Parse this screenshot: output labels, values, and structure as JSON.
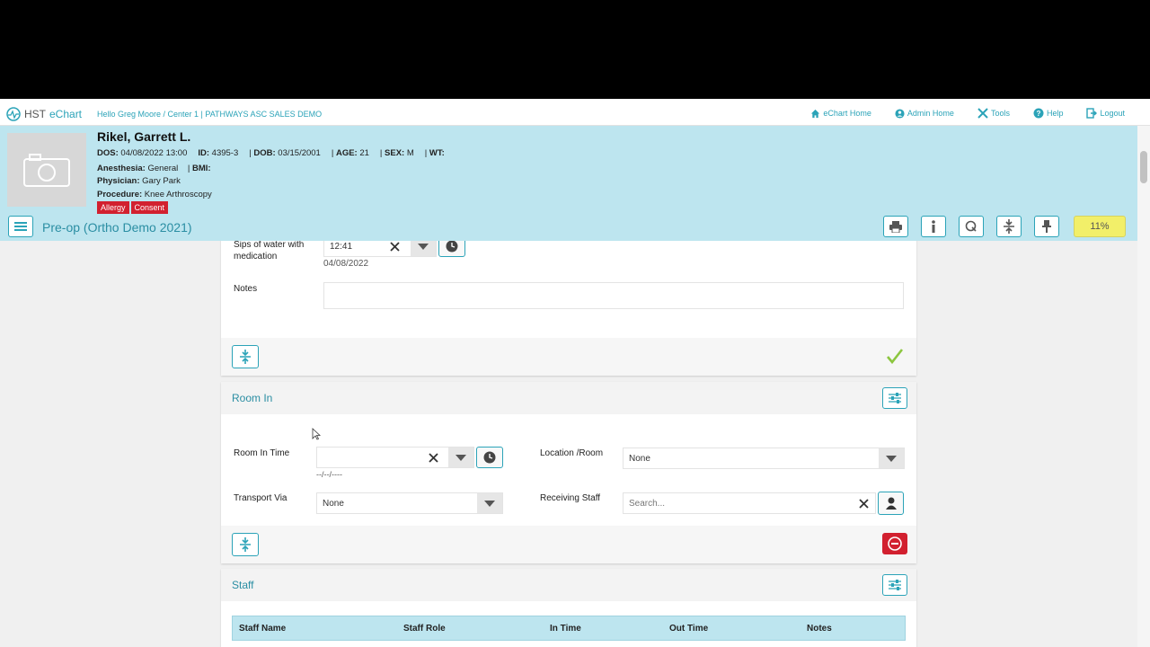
{
  "topbar": {
    "logo_text": "HST",
    "logo_accent": "eChart",
    "greeting": "Hello Greg Moore / Center 1 | PATHWAYS ASC SALES DEMO",
    "nav": [
      {
        "label": "eChart Home",
        "icon": "home-icon"
      },
      {
        "label": "Admin Home",
        "icon": "user-circle-icon"
      },
      {
        "label": "Tools",
        "icon": "tools-icon"
      },
      {
        "label": "Help",
        "icon": "help-icon"
      },
      {
        "label": "Logout",
        "icon": "logout-icon"
      }
    ]
  },
  "patient": {
    "name": "Rikel, Garrett L.",
    "dos_label": "DOS:",
    "dos": "04/08/2022 13:00",
    "id_label": "ID:",
    "id": "4395-3",
    "dob_label": "DOB:",
    "dob": "03/15/2001",
    "age_label": "AGE:",
    "age": "21",
    "sex_label": "SEX:",
    "sex": "M",
    "wt_label": "WT:",
    "anesthesia_label": "Anesthesia:",
    "anesthesia": "General",
    "bmi_label": "BMI:",
    "physician_label": "Physician:",
    "physician": "Gary Park",
    "procedure_label": "Procedure:",
    "procedure": "Knee Arthroscopy",
    "badges": [
      "Allergy",
      "Consent"
    ]
  },
  "page": {
    "title": "Pre-op (Ortho Demo 2021)",
    "progress": "11%"
  },
  "sips": {
    "label": "Sips of water with medication",
    "time": "12:41",
    "date": "04/08/2022",
    "notes_label": "Notes"
  },
  "room_in": {
    "title": "Room In",
    "room_in_time_label": "Room In Time",
    "room_in_time_value": "",
    "room_in_date_placeholder": "--/--/----",
    "location_label": "Location /Room",
    "location_value": "None",
    "transport_label": "Transport Via",
    "transport_value": "None",
    "receiving_label": "Receiving Staff",
    "receiving_placeholder": "Search..."
  },
  "staff": {
    "title": "Staff",
    "columns": [
      "Staff Name",
      "Staff Role",
      "In Time",
      "Out Time",
      "Notes"
    ]
  },
  "colors": {
    "accent": "#2ba3b8",
    "header_bg": "#bde5ef",
    "danger": "#d2202f",
    "progress_bg": "#f2ef69",
    "check": "#8cc63f"
  }
}
